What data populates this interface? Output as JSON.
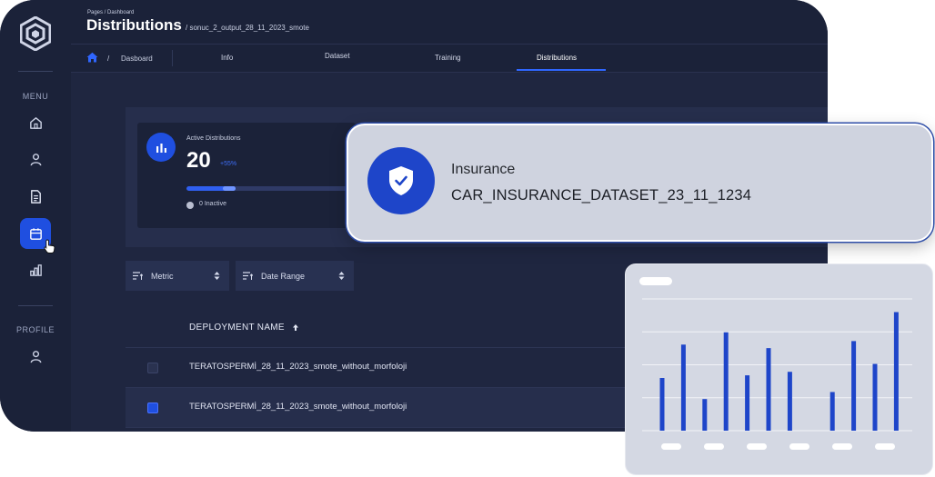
{
  "sidebar": {
    "menu_label": "MENU",
    "profile_label": "PROFILE",
    "items": [
      {
        "icon": "home-icon"
      },
      {
        "icon": "user-icon"
      },
      {
        "icon": "document-icon"
      },
      {
        "icon": "calendar-icon",
        "active": true
      },
      {
        "icon": "bar-chart-icon"
      }
    ],
    "profile_items": [
      {
        "icon": "user-icon"
      }
    ]
  },
  "header": {
    "breadcrumb_small": "Pages / Dashboard",
    "title": "Distributions",
    "file_name": "/   sonuc_2_output_28_11_2023_smote"
  },
  "tabbar": {
    "slash": "/",
    "crumb": "Dasboard",
    "tabs": [
      {
        "label": "Info"
      },
      {
        "label": "Dataset"
      },
      {
        "label": "Training"
      },
      {
        "label": "Distributions",
        "active": true
      }
    ]
  },
  "stats": {
    "label": "Active Distributions",
    "value": "20",
    "delta": "+55%",
    "progress": 0.3,
    "inactive": "0 Inactive"
  },
  "filters": [
    {
      "label": "Metric"
    },
    {
      "label": "Date Range"
    }
  ],
  "table": {
    "header": "DEPLOYMENT NAME",
    "rows": [
      {
        "name": "TERATOSPERMİ_28_11_2023_smote_without_morfoloji",
        "checked": false
      },
      {
        "name": "TERATOSPERMİ_28_11_2023_smote_without_morfoloji",
        "checked": true
      }
    ]
  },
  "toast": {
    "icon": "shield-check-icon",
    "title": "Insurance",
    "subtitle": "CAR_INSURANCE_DATASET_23_11_1234"
  },
  "colors": {
    "accent": "#1f4fe0",
    "app_bg": "#1e2540",
    "bar": "#1e45c9"
  },
  "chart_data": {
    "type": "bar",
    "values": [
      60,
      98,
      36,
      112,
      63,
      94,
      67,
      0,
      44,
      102,
      76,
      135
    ],
    "ylim": [
      0,
      150
    ],
    "grid": true
  }
}
